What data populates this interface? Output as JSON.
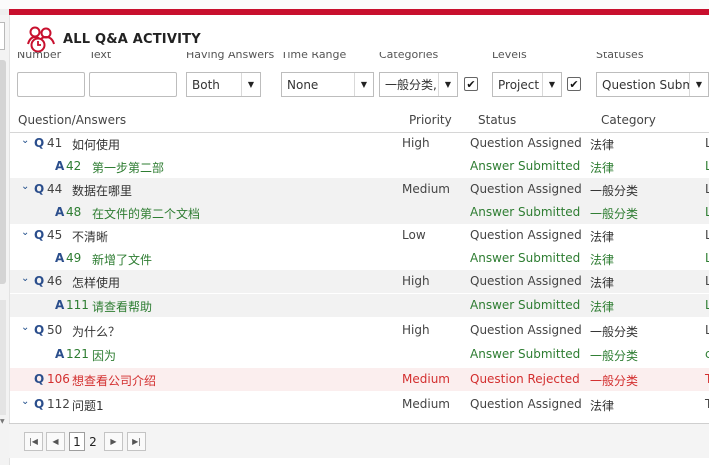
{
  "header": {
    "title": "ALL Q&A ACTIVITY",
    "icon": "group-clock-icon",
    "accent": "#c8102e"
  },
  "filters": {
    "labels": [
      "Number",
      "Text",
      "Having Answers",
      "Time Range",
      "Categories",
      "Levels",
      "Statuses"
    ],
    "number_value": "",
    "text_value": "",
    "having_answers": "Both",
    "time_range": "None",
    "category": "一般分类,",
    "category_checked": true,
    "level": "Project",
    "level_checked": true,
    "status": "Question Subm"
  },
  "columns": [
    "Question/Answers",
    "Priority",
    "Status",
    "Category"
  ],
  "rows": [
    {
      "kind": "q",
      "toggle": "⌄",
      "label": "Q",
      "num": "41",
      "title": "如何使用",
      "priority": "High",
      "status": "Question Assigned",
      "category": "法律",
      "edge": "L"
    },
    {
      "kind": "a",
      "label": "A",
      "num": "42",
      "title": "第一步第二部",
      "priority": "",
      "status": "Answer Submitted",
      "category": "法律",
      "edge": "L"
    },
    {
      "kind": "q",
      "toggle": "⌄",
      "label": "Q",
      "num": "44",
      "title": "数据在哪里",
      "priority": "Medium",
      "status": "Question Assigned",
      "category": "一般分类",
      "edge": "L"
    },
    {
      "kind": "a",
      "label": "A",
      "num": "48",
      "title": "在文件的第二个文档",
      "priority": "",
      "status": "Answer Submitted",
      "category": "一般分类",
      "edge": "L"
    },
    {
      "kind": "q",
      "toggle": "⌄",
      "label": "Q",
      "num": "45",
      "title": "不清晰",
      "priority": "Low",
      "status": "Question Assigned",
      "category": "法律",
      "edge": "L"
    },
    {
      "kind": "a",
      "label": "A",
      "num": "49",
      "title": "新增了文件",
      "priority": "",
      "status": "Answer Submitted",
      "category": "法律",
      "edge": "L"
    },
    {
      "kind": "q",
      "toggle": "⌄",
      "label": "Q",
      "num": "46",
      "title": "怎样使用",
      "priority": "High",
      "status": "Question Assigned",
      "category": "法律",
      "edge": "L"
    },
    {
      "kind": "a",
      "label": "A",
      "num": "111",
      "title": "请查看帮助",
      "priority": "",
      "status": "Answer Submitted",
      "category": "法律",
      "edge": "L"
    },
    {
      "kind": "q",
      "toggle": "⌄",
      "label": "Q",
      "num": "50",
      "title": "为什么？",
      "priority": "High",
      "status": "Question Assigned",
      "category": "一般分类",
      "edge": "L"
    },
    {
      "kind": "a",
      "label": "A",
      "num": "121",
      "title": "因为",
      "priority": "",
      "status": "Answer Submitted",
      "category": "一般分类",
      "edge": "c"
    },
    {
      "kind": "rej",
      "toggle": "",
      "label": "Q",
      "num": "106",
      "title": "想查看公司介绍",
      "priority": "Medium",
      "status": "Question Rejected",
      "category": "一般分类",
      "edge": "T"
    },
    {
      "kind": "q",
      "toggle": "⌄",
      "label": "Q",
      "num": "112",
      "title": "问题1",
      "priority": "Medium",
      "status": "Question Assigned",
      "category": "法律",
      "edge": "T"
    }
  ],
  "pager": {
    "current": "1",
    "other": "2",
    "first_icon": "first-page-icon",
    "prev_icon": "prev-page-icon",
    "next_icon": "next-page-icon",
    "last_icon": "last-page-icon"
  }
}
